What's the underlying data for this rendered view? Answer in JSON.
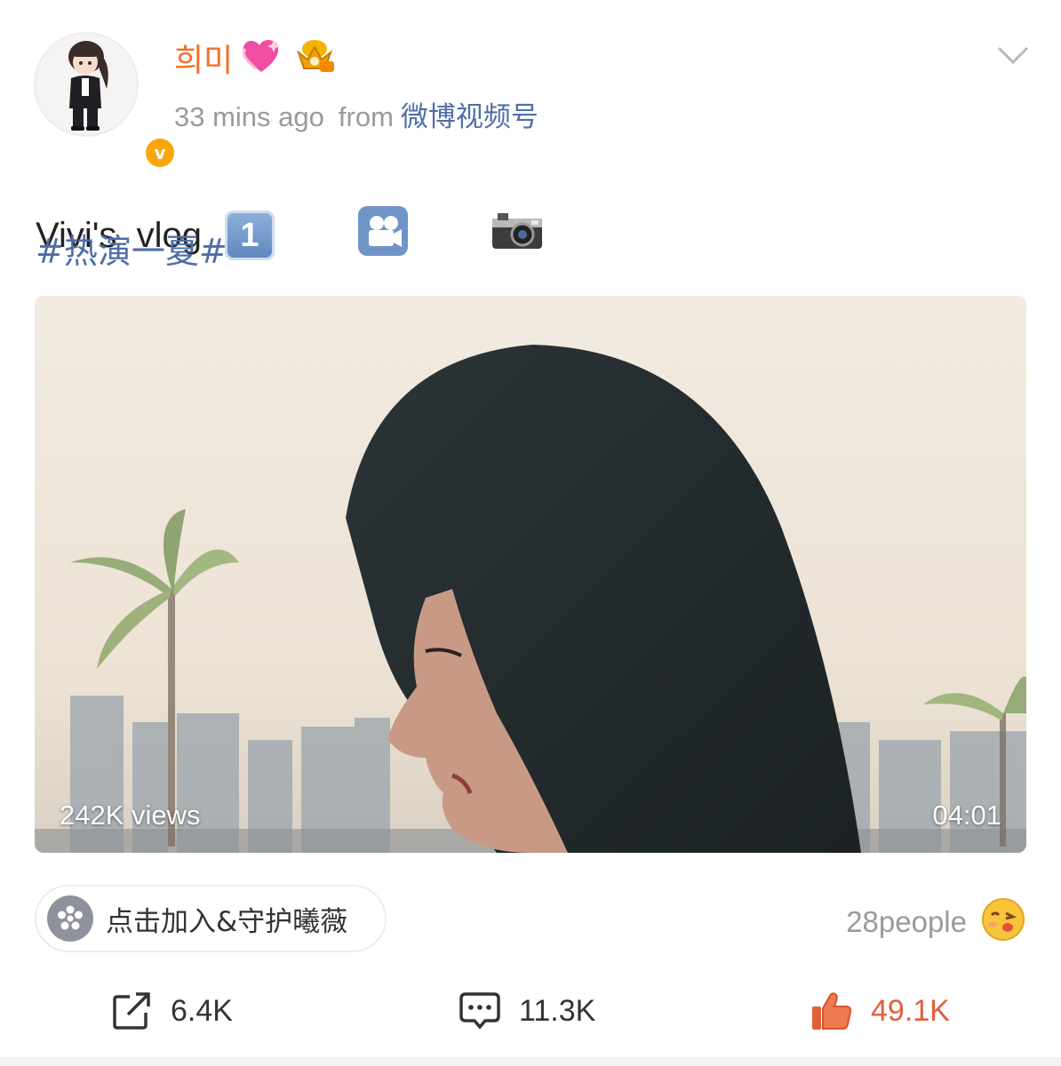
{
  "author": {
    "name": "희미",
    "avatar_icon": "chibi-avatar",
    "verified_icon": "verified-v-icon",
    "verified_letter": "v",
    "badges": [
      "sparkling-heart-icon",
      "crown-icon"
    ]
  },
  "meta": {
    "time": "33 mins ago",
    "from_label": "from",
    "source": "微博视频号"
  },
  "post": {
    "text": "Vivi's  vlog",
    "emojis": [
      "keycap-1",
      "movie-camera-icon",
      "camera-icon"
    ],
    "keycap_label": "1",
    "hashtag": "#热演一夏#"
  },
  "video": {
    "views": "242K views",
    "duration": "04:01"
  },
  "topic": {
    "label": "点击加入&守护曦薇",
    "icon": "super-topic-icon"
  },
  "reactions": {
    "people": "28people",
    "icon": "kiss-face-icon"
  },
  "actions": {
    "repost": "6.4K",
    "comment": "11.3K",
    "like": "49.1K"
  },
  "colors": {
    "username": "#f2702b",
    "link": "#4e6ea6",
    "like": "#e0603a",
    "muted": "#9a9a9a"
  }
}
